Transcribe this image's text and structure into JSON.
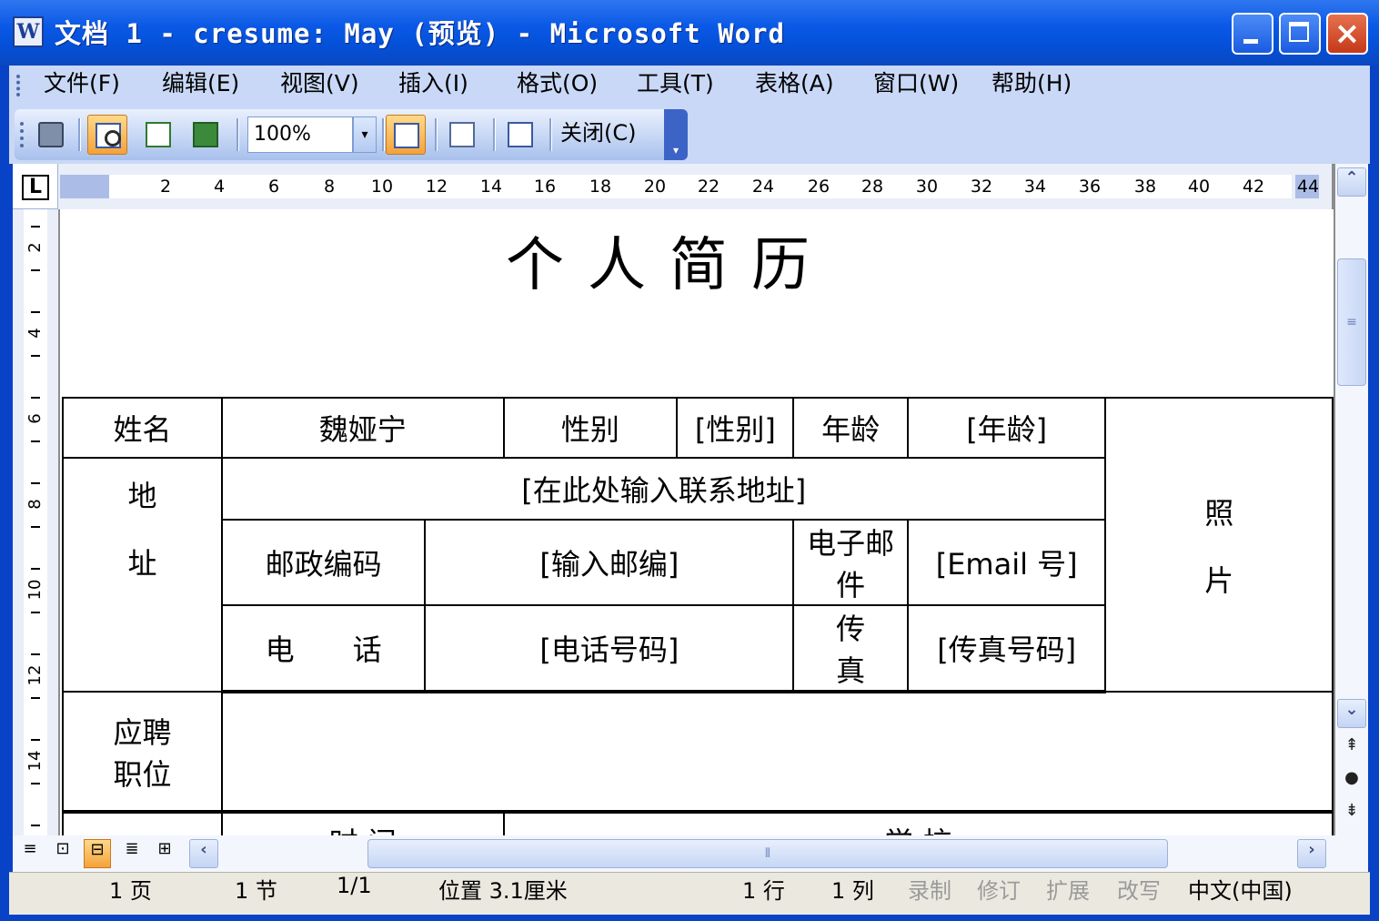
{
  "window": {
    "title": "文档 1 - cresume: May (预览) - Microsoft Word",
    "app_icon": "word-document-icon",
    "controls": {
      "minimize": "minimize-icon",
      "maximize": "maximize-icon",
      "close": "×"
    }
  },
  "menu": [
    "文件(F)",
    "编辑(E)",
    "视图(V)",
    "插入(I)",
    "格式(O)",
    "工具(T)",
    "表格(A)",
    "窗口(W)",
    "帮助(H)"
  ],
  "toolbar": {
    "zoom_value": "100%",
    "zoom_arrow": "▾",
    "close_label": "关闭(C)",
    "icons": [
      "print-icon",
      "magnifier-icon",
      "one-page-icon",
      "multiple-pages-icon",
      "view-ruler-icon",
      "shrink-to-fit-icon",
      "full-screen-icon"
    ]
  },
  "ruler": {
    "tab_selector": "L",
    "horizontal_ticks": [
      "2",
      "4",
      "6",
      "8",
      "10",
      "12",
      "14",
      "16",
      "18",
      "20",
      "22",
      "24",
      "26",
      "28",
      "30",
      "32",
      "34",
      "36",
      "38",
      "40",
      "42",
      "44"
    ],
    "vertical_ticks": [
      "2",
      "4",
      "6",
      "8",
      "10",
      "12",
      "14"
    ]
  },
  "document": {
    "title": "个人简历",
    "table": {
      "name_label": "姓名",
      "name_value": "魏娅宁",
      "gender_label": "性别",
      "gender_value": "[性别]",
      "age_label": "年龄",
      "age_value": "[年龄]",
      "photo_label_1": "照",
      "photo_label_2": "片",
      "address_label_1": "地",
      "address_label_2": "址",
      "address_value": "[在此处输入联系地址]",
      "postcode_label": "邮政编码",
      "postcode_value": "[输入邮编]",
      "email_label": "电子邮件",
      "email_value": "[Email 号]",
      "phone_label": "电　　话",
      "phone_value": "[电话号码]",
      "fax_label": "传　　真",
      "fax_value": "[传真号码]",
      "position_label_1": "应聘",
      "position_label_2": "职位",
      "position_value": "",
      "time_header": "时 间",
      "school_header": "学 校"
    }
  },
  "scroll": {
    "up": "⌃",
    "down": "⌄",
    "left": "‹",
    "right": "›",
    "grip": "≡",
    "hgrip": "⦀",
    "prev_page": "⇞",
    "select_browse": "●",
    "next_page": "⇟"
  },
  "view_buttons": [
    "≡",
    "⊡",
    "⊟",
    "≣",
    "⊞"
  ],
  "status": {
    "page": "1 页",
    "section": "1 节",
    "page_of": "1/1",
    "position": "位置 3.1厘米",
    "line": "1 行",
    "column": "1 列",
    "rec": "录制",
    "trk": "修订",
    "ext": "扩展",
    "ovr": "改写",
    "language": "中文(中国)"
  }
}
